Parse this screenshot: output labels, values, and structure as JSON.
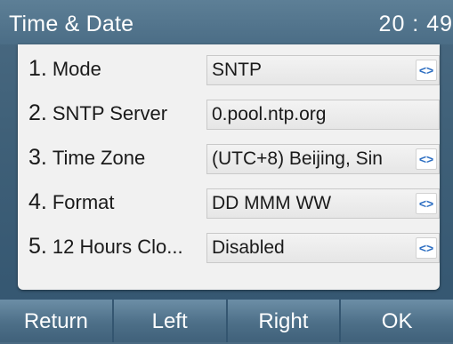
{
  "header": {
    "title": "Time & Date",
    "clock": "20 : 49"
  },
  "rows": [
    {
      "num": "1.",
      "label": "Mode",
      "value": "SNTP",
      "has_arrow": true
    },
    {
      "num": "2.",
      "label": "SNTP Server",
      "value": "0.pool.ntp.org",
      "has_arrow": false
    },
    {
      "num": "3.",
      "label": "Time Zone",
      "value": "(UTC+8) Beijing, Sin",
      "has_arrow": true
    },
    {
      "num": "4.",
      "label": "Format",
      "value": "DD MMM WW",
      "has_arrow": true
    },
    {
      "num": "5.",
      "label": "12 Hours Clo...",
      "value": "Disabled",
      "has_arrow": true
    }
  ],
  "arrow_glyph": "<>",
  "softkeys": [
    "Return",
    "Left",
    "Right",
    "OK"
  ],
  "colors": {
    "accent": "#2e6fc2",
    "titlebar": "#4b6d86",
    "panel": "#f1f1f1"
  }
}
